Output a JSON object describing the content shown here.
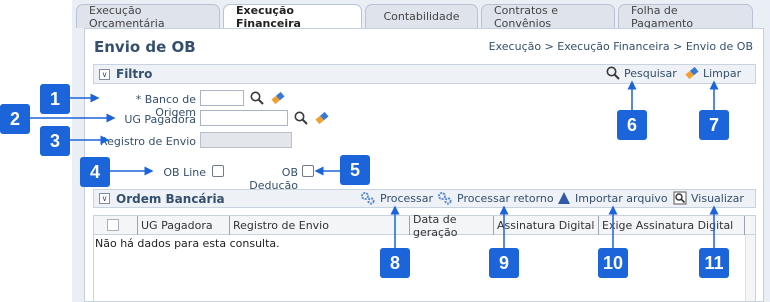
{
  "tabs": [
    {
      "label": "Execução Orçamentária",
      "active": false
    },
    {
      "label": "Execução Financeira",
      "active": true
    },
    {
      "label": "Contabilidade",
      "active": false
    },
    {
      "label": "Contratos e Convênios",
      "active": false
    },
    {
      "label": "Folha de Pagamento",
      "active": false
    }
  ],
  "page": {
    "title": "Envio de OB",
    "breadcrumb": "Execução > Execução Financeira > Envio de OB"
  },
  "filter": {
    "section_title": "Filtro",
    "search_label": "Pesquisar",
    "clear_label": "Limpar",
    "banco_origem_label": "* Banco de Origem",
    "banco_origem_value": "",
    "ug_pagadora_label": "UG Pagadora",
    "ug_pagadora_value": "",
    "registro_envio_label": "Registro de Envio",
    "registro_envio_value": "",
    "ob_line_label": "OB Line",
    "ob_deducao_label": "OB Dedução"
  },
  "ordem": {
    "section_title": "Ordem Bancária",
    "processar_label": "Processar",
    "processar_retorno_label": "Processar retorno",
    "importar_label": "Importar arquivo",
    "visualizar_label": "Visualizar",
    "columns": [
      "UG Pagadora",
      "Registro de Envio",
      "Data de geração",
      "Assinatura Digital",
      "Exige Assinatura Digital"
    ],
    "empty_message": "Não há dados para esta consulta."
  },
  "annotations": [
    "1",
    "2",
    "3",
    "4",
    "5",
    "6",
    "7",
    "8",
    "9",
    "10",
    "11"
  ],
  "colors": {
    "badge": "#1b64d9",
    "title_text": "#34506e",
    "tab_active": "#ffffff",
    "tab_inactive": "#dfe4ec"
  }
}
